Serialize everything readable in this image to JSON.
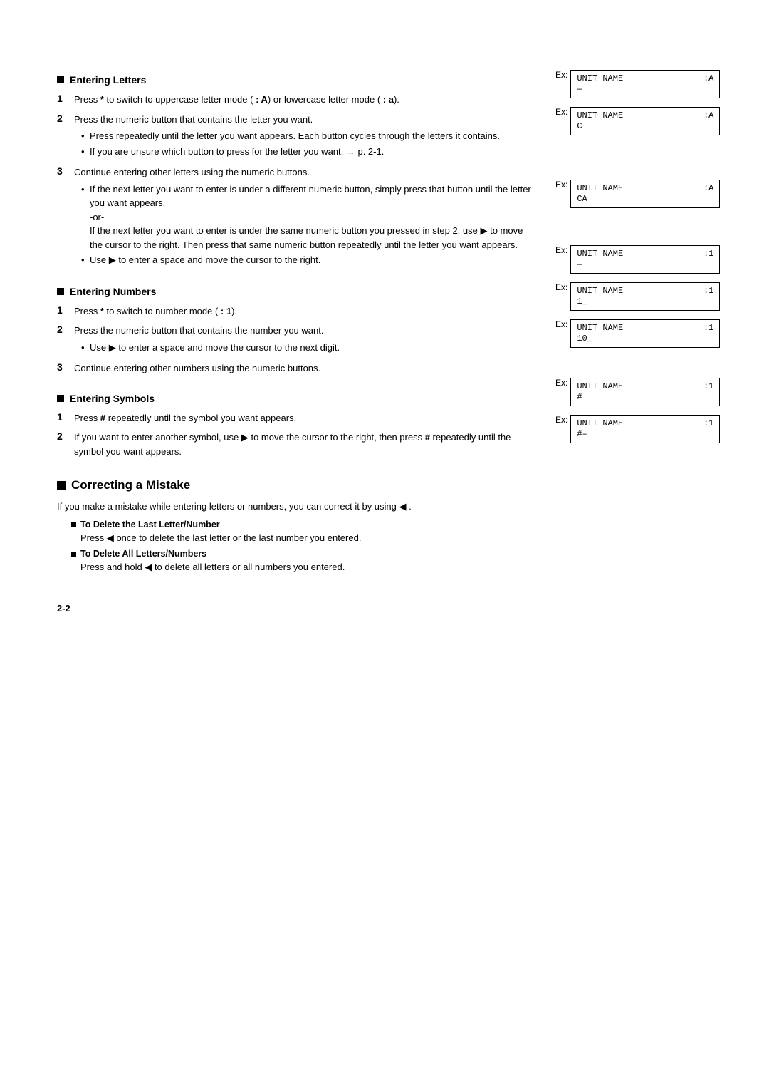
{
  "page": {
    "number": "2-2"
  },
  "sections": {
    "entering_letters": {
      "header": "Entering Letters",
      "steps": [
        {
          "number": "1",
          "text": "Press * to switch to uppercase letter mode ( : A) or lowercase letter mode ( : a)."
        },
        {
          "number": "2",
          "text": "Press the numeric button that contains the letter you want.",
          "bullets": [
            "Press repeatedly until the letter you want appears. Each button cycles through the letters it contains.",
            "If you are unsure which button to press for the letter you want, → p. 2-1."
          ]
        },
        {
          "number": "3",
          "text": "Continue entering other letters using the numeric buttons.",
          "bullets": [
            "If the next letter you want to enter is under a different numeric button, simply press that button until the letter you want appears.",
            "-or-\nIf the next letter you want to enter is under the same numeric button you pressed in step 2, use ▶ to move the cursor to the right. Then press that same numeric button repeatedly until the letter you want appears.",
            "Use ▶ to enter a space and move the cursor to the right."
          ]
        }
      ],
      "examples": [
        {
          "label": "Ex:",
          "lcd_line1": "UNIT NAME",
          "lcd_mode": ":A",
          "lcd_line2": "—"
        },
        {
          "label": "Ex:",
          "lcd_line1": "UNIT NAME",
          "lcd_mode": ":A",
          "lcd_line2": "C"
        },
        {
          "label": "Ex:",
          "lcd_line1": "UNIT NAME",
          "lcd_mode": ":A",
          "lcd_line2": "CA"
        }
      ]
    },
    "entering_numbers": {
      "header": "Entering Numbers",
      "steps": [
        {
          "number": "1",
          "text": "Press * to switch to number mode ( : 1)."
        },
        {
          "number": "2",
          "text": "Press the numeric button that contains the number you want.",
          "bullets": [
            "Use ▶ to enter a space and move the cursor to the next digit."
          ]
        },
        {
          "number": "3",
          "text": "Continue entering other numbers using the numeric buttons."
        }
      ],
      "examples": [
        {
          "label": "Ex:",
          "lcd_line1": "UNIT NAME",
          "lcd_mode": ":1",
          "lcd_line2": "—"
        },
        {
          "label": "Ex:",
          "lcd_line1": "UNIT NAME",
          "lcd_mode": ":1",
          "lcd_line2": "1_"
        },
        {
          "label": "Ex:",
          "lcd_line1": "UNIT NAME",
          "lcd_mode": ":1",
          "lcd_line2": "10_"
        }
      ]
    },
    "entering_symbols": {
      "header": "Entering Symbols",
      "steps": [
        {
          "number": "1",
          "text": "Press # repeatedly until the symbol you want appears."
        },
        {
          "number": "2",
          "text": "If you want to enter another symbol, use ▶ to move the cursor to the right, then press # repeatedly until the symbol you want appears."
        }
      ],
      "examples": [
        {
          "label": "Ex:",
          "lcd_line1": "UNIT NAME",
          "lcd_mode": ":1",
          "lcd_line2": "#"
        },
        {
          "label": "Ex:",
          "lcd_line1": "UNIT NAME",
          "lcd_mode": ":1",
          "lcd_line2": "#–"
        }
      ]
    },
    "correcting_mistake": {
      "header": "Correcting a Mistake",
      "intro": "If you make a mistake while entering letters or numbers, you can correct it by using ◀ .",
      "sub_sections": [
        {
          "header": "To Delete the Last Letter/Number",
          "text": "Press ◀ once to delete the last letter or the last number you entered."
        },
        {
          "header": "To Delete All Letters/Numbers",
          "text": "Press and hold ◀ to delete all letters or all numbers you entered."
        }
      ]
    }
  }
}
